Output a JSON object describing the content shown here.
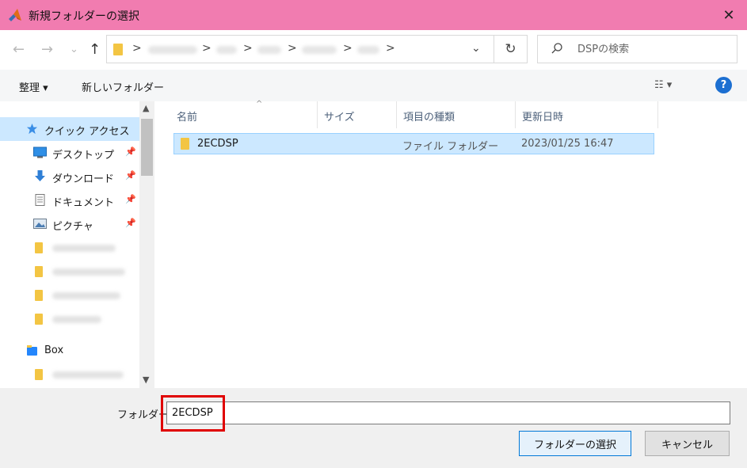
{
  "window": {
    "title": "新規フォルダーの選択",
    "close_glyph": "✕",
    "titlebar_color": "#f17cb0"
  },
  "nav": {
    "back_glyph": "←",
    "forward_glyph": "→",
    "recent_glyph": "⌄",
    "up_glyph": "↑",
    "refresh_glyph": "↻",
    "dropdown_glyph": "⌄",
    "crumb_separator": ">"
  },
  "search": {
    "placeholder": "DSPの検索"
  },
  "toolbar": {
    "organize_label": "整理 ▾",
    "new_folder_label": "新しいフォルダー",
    "view_label": "☷ ▾",
    "help_label": "?"
  },
  "navpane": {
    "quick_access": "クイック アクセス",
    "items": [
      {
        "label": "デスクトップ",
        "icon": "desktop-icon",
        "pinned": true
      },
      {
        "label": "ダウンロード",
        "icon": "download-icon",
        "pinned": true
      },
      {
        "label": "ドキュメント",
        "icon": "document-icon",
        "pinned": true
      },
      {
        "label": "ピクチャ",
        "icon": "pictures-icon",
        "pinned": true
      }
    ],
    "box_label": "Box",
    "pin_glyph": "📌"
  },
  "filelist": {
    "columns": [
      "名前",
      "サイズ",
      "項目の種類",
      "更新日時"
    ],
    "rows": [
      {
        "name": "2ECDSP",
        "size": "",
        "type": "ファイル フォルダー",
        "modified": "2023/01/25 16:47"
      }
    ]
  },
  "footer": {
    "folder_label": "フォルダー",
    "folder_value": "2ECDSP",
    "select_button": "フォルダーの選択",
    "cancel_button": "キャンセル"
  }
}
